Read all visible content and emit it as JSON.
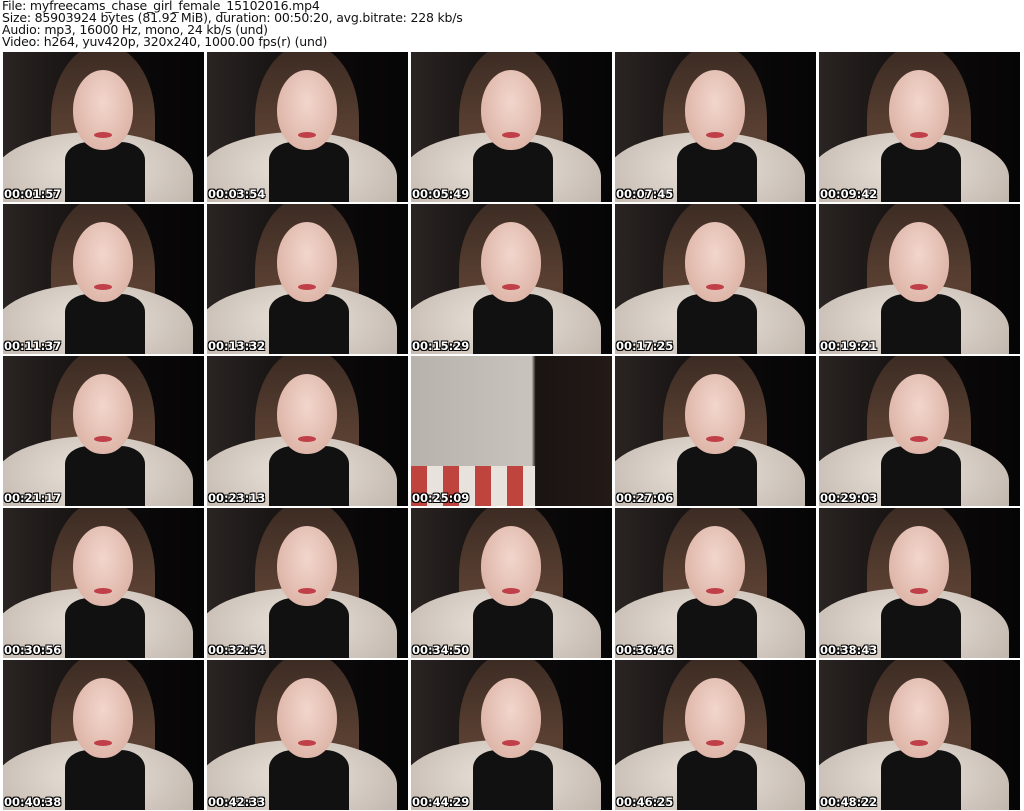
{
  "header": {
    "file": "File: myfreecams_chase_girl_female_15102016.mp4",
    "size": "Size: 85903924 bytes (81.92 MiB), duration: 00:50:20, avg.bitrate: 228 kb/s",
    "audio": "Audio: mp3, 16000 Hz, mono, 24 kb/s (und)",
    "video": "Video: h264, yuv420p, 320x240, 1000.00 fps(r) (und)"
  },
  "thumbnails": [
    {
      "time": "00:01:57",
      "scene": "person"
    },
    {
      "time": "00:03:54",
      "scene": "person"
    },
    {
      "time": "00:05:49",
      "scene": "person"
    },
    {
      "time": "00:07:45",
      "scene": "person"
    },
    {
      "time": "00:09:42",
      "scene": "person"
    },
    {
      "time": "00:11:37",
      "scene": "person"
    },
    {
      "time": "00:13:32",
      "scene": "person"
    },
    {
      "time": "00:15:29",
      "scene": "person"
    },
    {
      "time": "00:17:25",
      "scene": "person"
    },
    {
      "time": "00:19:21",
      "scene": "person"
    },
    {
      "time": "00:21:17",
      "scene": "person"
    },
    {
      "time": "00:23:13",
      "scene": "person"
    },
    {
      "time": "00:25:09",
      "scene": "room"
    },
    {
      "time": "00:27:06",
      "scene": "person"
    },
    {
      "time": "00:29:03",
      "scene": "person"
    },
    {
      "time": "00:30:56",
      "scene": "person"
    },
    {
      "time": "00:32:54",
      "scene": "person"
    },
    {
      "time": "00:34:50",
      "scene": "person"
    },
    {
      "time": "00:36:46",
      "scene": "person"
    },
    {
      "time": "00:38:43",
      "scene": "person"
    },
    {
      "time": "00:40:38",
      "scene": "person"
    },
    {
      "time": "00:42:33",
      "scene": "person"
    },
    {
      "time": "00:44:29",
      "scene": "person"
    },
    {
      "time": "00:46:25",
      "scene": "person"
    },
    {
      "time": "00:48:22",
      "scene": "person"
    }
  ]
}
